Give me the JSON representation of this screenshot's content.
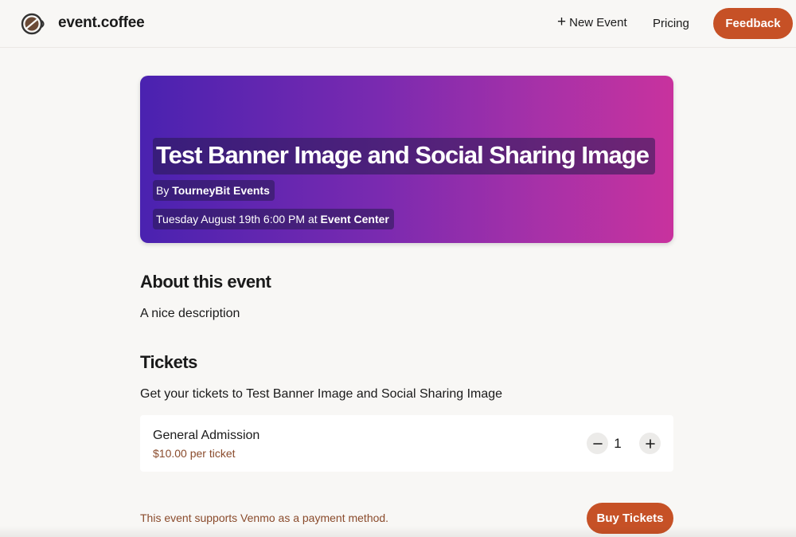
{
  "header": {
    "brand": "event.coffee",
    "new_event_label": "New Event",
    "pricing_label": "Pricing",
    "feedback_label": "Feedback"
  },
  "banner": {
    "title": "Test Banner Image and Social Sharing Image",
    "by_prefix": "By",
    "organizer": "TourneyBit Events",
    "datetime": "Tuesday August 19th 6:00 PM",
    "at_word": "at",
    "venue": "Event Center"
  },
  "about": {
    "heading": "About this event",
    "description": "A nice description"
  },
  "tickets": {
    "heading": "Tickets",
    "subtitle": "Get your tickets to Test Banner Image and Social Sharing Image",
    "items": [
      {
        "name": "General Admission",
        "price": "$10.00 per ticket",
        "quantity": "1"
      }
    ]
  },
  "footer": {
    "payment_note": "This event supports Venmo as a payment method.",
    "buy_label": "Buy Tickets"
  },
  "colors": {
    "accent": "#c65126",
    "price_text": "#8a4b2c",
    "background": "#f8f7f5"
  },
  "icons": {
    "logo": "coffee-cup-icon",
    "new_event": "plus-icon",
    "decrement": "minus-icon",
    "increment": "plus-icon"
  }
}
